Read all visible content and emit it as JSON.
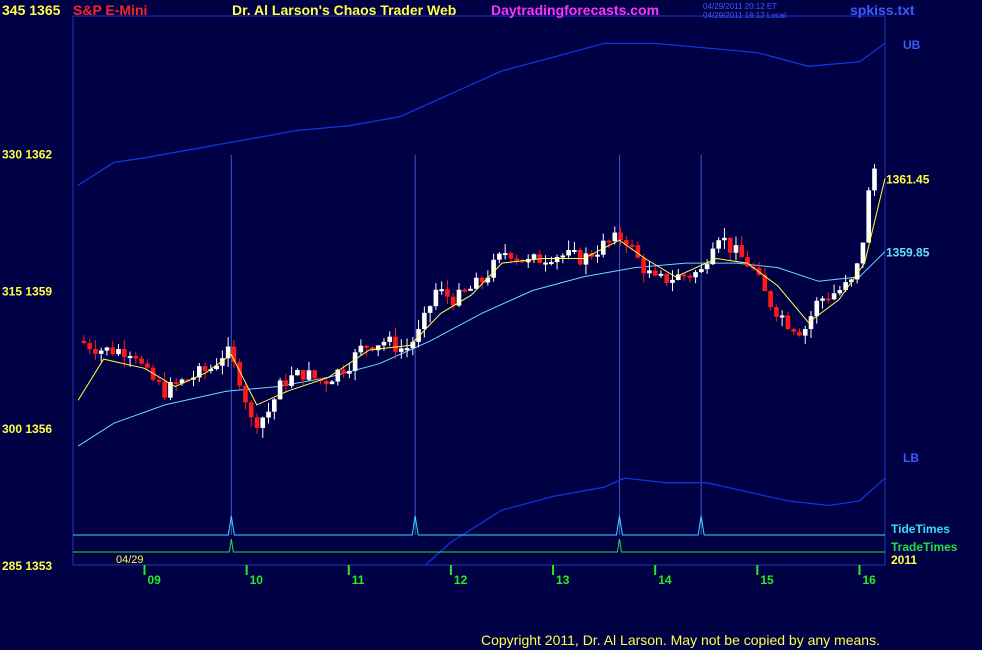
{
  "header": {
    "scale_top": "345 1365",
    "instrument": "S&P E-Mini",
    "title": "Dr. Al Larson's Chaos Trader Web",
    "site": "Daytradingforecasts.com",
    "stamp_et": "04/29/2011 20:12 ET",
    "stamp_local": "04/29/2011 16:12 Local",
    "filename": "spkiss.txt"
  },
  "footer": {
    "copyright": "Copyright 2011, Dr. Al Larson. May not be copied by any means."
  },
  "colors": {
    "background": "#000044",
    "up_candle": "#ffffff",
    "down_candle": "#ff1a1a",
    "fast_ma": "#ffff44",
    "slow_ma": "#66ddff",
    "bands": "#1133dd",
    "tide": "#33ddff",
    "trade": "#22dd44",
    "hours": "#22ee22"
  },
  "chart_data": {
    "type": "candlestick",
    "date_label": "04/29",
    "year_label": "2011",
    "y_left_labels": [
      {
        "value": 1365,
        "text": "345 1365"
      },
      {
        "value": 1362,
        "text": "330 1362"
      },
      {
        "value": 1359,
        "text": "315 1359"
      },
      {
        "value": 1356,
        "text": "300 1356"
      },
      {
        "value": 1353,
        "text": "285 1353"
      }
    ],
    "ylim": [
      1353,
      1365
    ],
    "xlim": [
      8.3,
      16.25
    ],
    "x_ticks": [
      {
        "value": 9,
        "label": "09"
      },
      {
        "value": 10,
        "label": "10"
      },
      {
        "value": 11,
        "label": "11"
      },
      {
        "value": 12,
        "label": "12"
      },
      {
        "value": 13,
        "label": "13"
      },
      {
        "value": 14,
        "label": "14"
      },
      {
        "value": 15,
        "label": "15"
      },
      {
        "value": 16,
        "label": "16"
      }
    ],
    "right_labels": {
      "ub": "UB",
      "lb": "LB",
      "fast_last": "1361.45",
      "slow_last": "1359.85",
      "tide": "TideTimes",
      "trade": "TradeTimes"
    },
    "fast_last_value": 1361.45,
    "slow_last_value": 1359.85,
    "tide_times": [
      9.85,
      11.65,
      13.65,
      14.45
    ],
    "trade_times": [
      9.85,
      13.65
    ],
    "close_path": [
      [
        8.35,
        1357.9
      ],
      [
        8.6,
        1357.7
      ],
      [
        8.9,
        1357.7
      ],
      [
        9.0,
        1357.2
      ],
      [
        9.2,
        1356.8
      ],
      [
        9.45,
        1357.1
      ],
      [
        9.65,
        1357.3
      ],
      [
        9.8,
        1357.7
      ],
      [
        9.95,
        1357.0
      ],
      [
        10.05,
        1356.1
      ],
      [
        10.2,
        1356.3
      ],
      [
        10.35,
        1357.0
      ],
      [
        10.55,
        1357.2
      ],
      [
        10.75,
        1357.0
      ],
      [
        11.0,
        1357.4
      ],
      [
        11.15,
        1357.8
      ],
      [
        11.35,
        1357.9
      ],
      [
        11.55,
        1357.7
      ],
      [
        11.7,
        1358.1
      ],
      [
        11.85,
        1359.0
      ],
      [
        12.05,
        1358.8
      ],
      [
        12.3,
        1359.2
      ],
      [
        12.55,
        1359.9
      ],
      [
        12.75,
        1359.6
      ],
      [
        13.0,
        1359.8
      ],
      [
        13.3,
        1359.7
      ],
      [
        13.5,
        1360.0
      ],
      [
        13.7,
        1360.2
      ],
      [
        13.85,
        1359.6
      ],
      [
        14.0,
        1359.2
      ],
      [
        14.2,
        1359.3
      ],
      [
        14.45,
        1359.4
      ],
      [
        14.6,
        1360.3
      ],
      [
        14.75,
        1359.9
      ],
      [
        14.95,
        1359.5
      ],
      [
        15.1,
        1358.8
      ],
      [
        15.3,
        1358.3
      ],
      [
        15.45,
        1358.1
      ],
      [
        15.6,
        1358.8
      ],
      [
        15.8,
        1359.0
      ],
      [
        15.95,
        1359.2
      ],
      [
        16.05,
        1360.3
      ],
      [
        16.12,
        1361.7
      ],
      [
        16.2,
        1361.6
      ]
    ],
    "fast_ma": [
      [
        8.35,
        1356.6
      ],
      [
        8.6,
        1357.5
      ],
      [
        9.0,
        1357.3
      ],
      [
        9.3,
        1356.9
      ],
      [
        9.6,
        1357.2
      ],
      [
        9.85,
        1357.6
      ],
      [
        10.1,
        1356.5
      ],
      [
        10.4,
        1356.8
      ],
      [
        10.8,
        1357.1
      ],
      [
        11.2,
        1357.7
      ],
      [
        11.6,
        1357.8
      ],
      [
        11.9,
        1358.5
      ],
      [
        12.2,
        1358.9
      ],
      [
        12.5,
        1359.6
      ],
      [
        12.9,
        1359.7
      ],
      [
        13.3,
        1359.7
      ],
      [
        13.65,
        1360.1
      ],
      [
        13.9,
        1359.7
      ],
      [
        14.2,
        1359.3
      ],
      [
        14.6,
        1359.7
      ],
      [
        14.9,
        1359.6
      ],
      [
        15.2,
        1359.1
      ],
      [
        15.5,
        1358.3
      ],
      [
        15.8,
        1358.8
      ],
      [
        16.05,
        1359.6
      ],
      [
        16.25,
        1361.45
      ]
    ],
    "slow_ma": [
      [
        8.35,
        1355.6
      ],
      [
        8.7,
        1356.1
      ],
      [
        9.2,
        1356.5
      ],
      [
        9.8,
        1356.8
      ],
      [
        10.3,
        1356.9
      ],
      [
        10.8,
        1357.1
      ],
      [
        11.3,
        1357.4
      ],
      [
        11.8,
        1357.9
      ],
      [
        12.3,
        1358.5
      ],
      [
        12.8,
        1359.0
      ],
      [
        13.3,
        1359.3
      ],
      [
        13.8,
        1359.5
      ],
      [
        14.3,
        1359.6
      ],
      [
        14.8,
        1359.6
      ],
      [
        15.2,
        1359.5
      ],
      [
        15.6,
        1359.2
      ],
      [
        16.0,
        1359.3
      ],
      [
        16.25,
        1359.85
      ]
    ],
    "upper_band": [
      [
        8.35,
        1361.3
      ],
      [
        8.7,
        1361.8
      ],
      [
        9.0,
        1361.9
      ],
      [
        9.5,
        1362.1
      ],
      [
        10.0,
        1362.3
      ],
      [
        10.5,
        1362.5
      ],
      [
        11.0,
        1362.6
      ],
      [
        11.5,
        1362.8
      ],
      [
        12.0,
        1363.3
      ],
      [
        12.5,
        1363.8
      ],
      [
        13.0,
        1364.1
      ],
      [
        13.5,
        1364.4
      ],
      [
        14.0,
        1364.4
      ],
      [
        14.5,
        1364.3
      ],
      [
        15.0,
        1364.2
      ],
      [
        15.5,
        1363.9
      ],
      [
        16.0,
        1364.0
      ],
      [
        16.25,
        1364.4
      ]
    ],
    "lower_band": [
      [
        11.75,
        1353.0
      ],
      [
        12.0,
        1353.5
      ],
      [
        12.5,
        1354.2
      ],
      [
        13.0,
        1354.5
      ],
      [
        13.5,
        1354.7
      ],
      [
        13.7,
        1354.9
      ],
      [
        14.1,
        1354.8
      ],
      [
        14.5,
        1354.8
      ],
      [
        14.9,
        1354.6
      ],
      [
        15.3,
        1354.4
      ],
      [
        15.7,
        1354.3
      ],
      [
        16.0,
        1354.4
      ],
      [
        16.25,
        1354.9
      ]
    ]
  }
}
